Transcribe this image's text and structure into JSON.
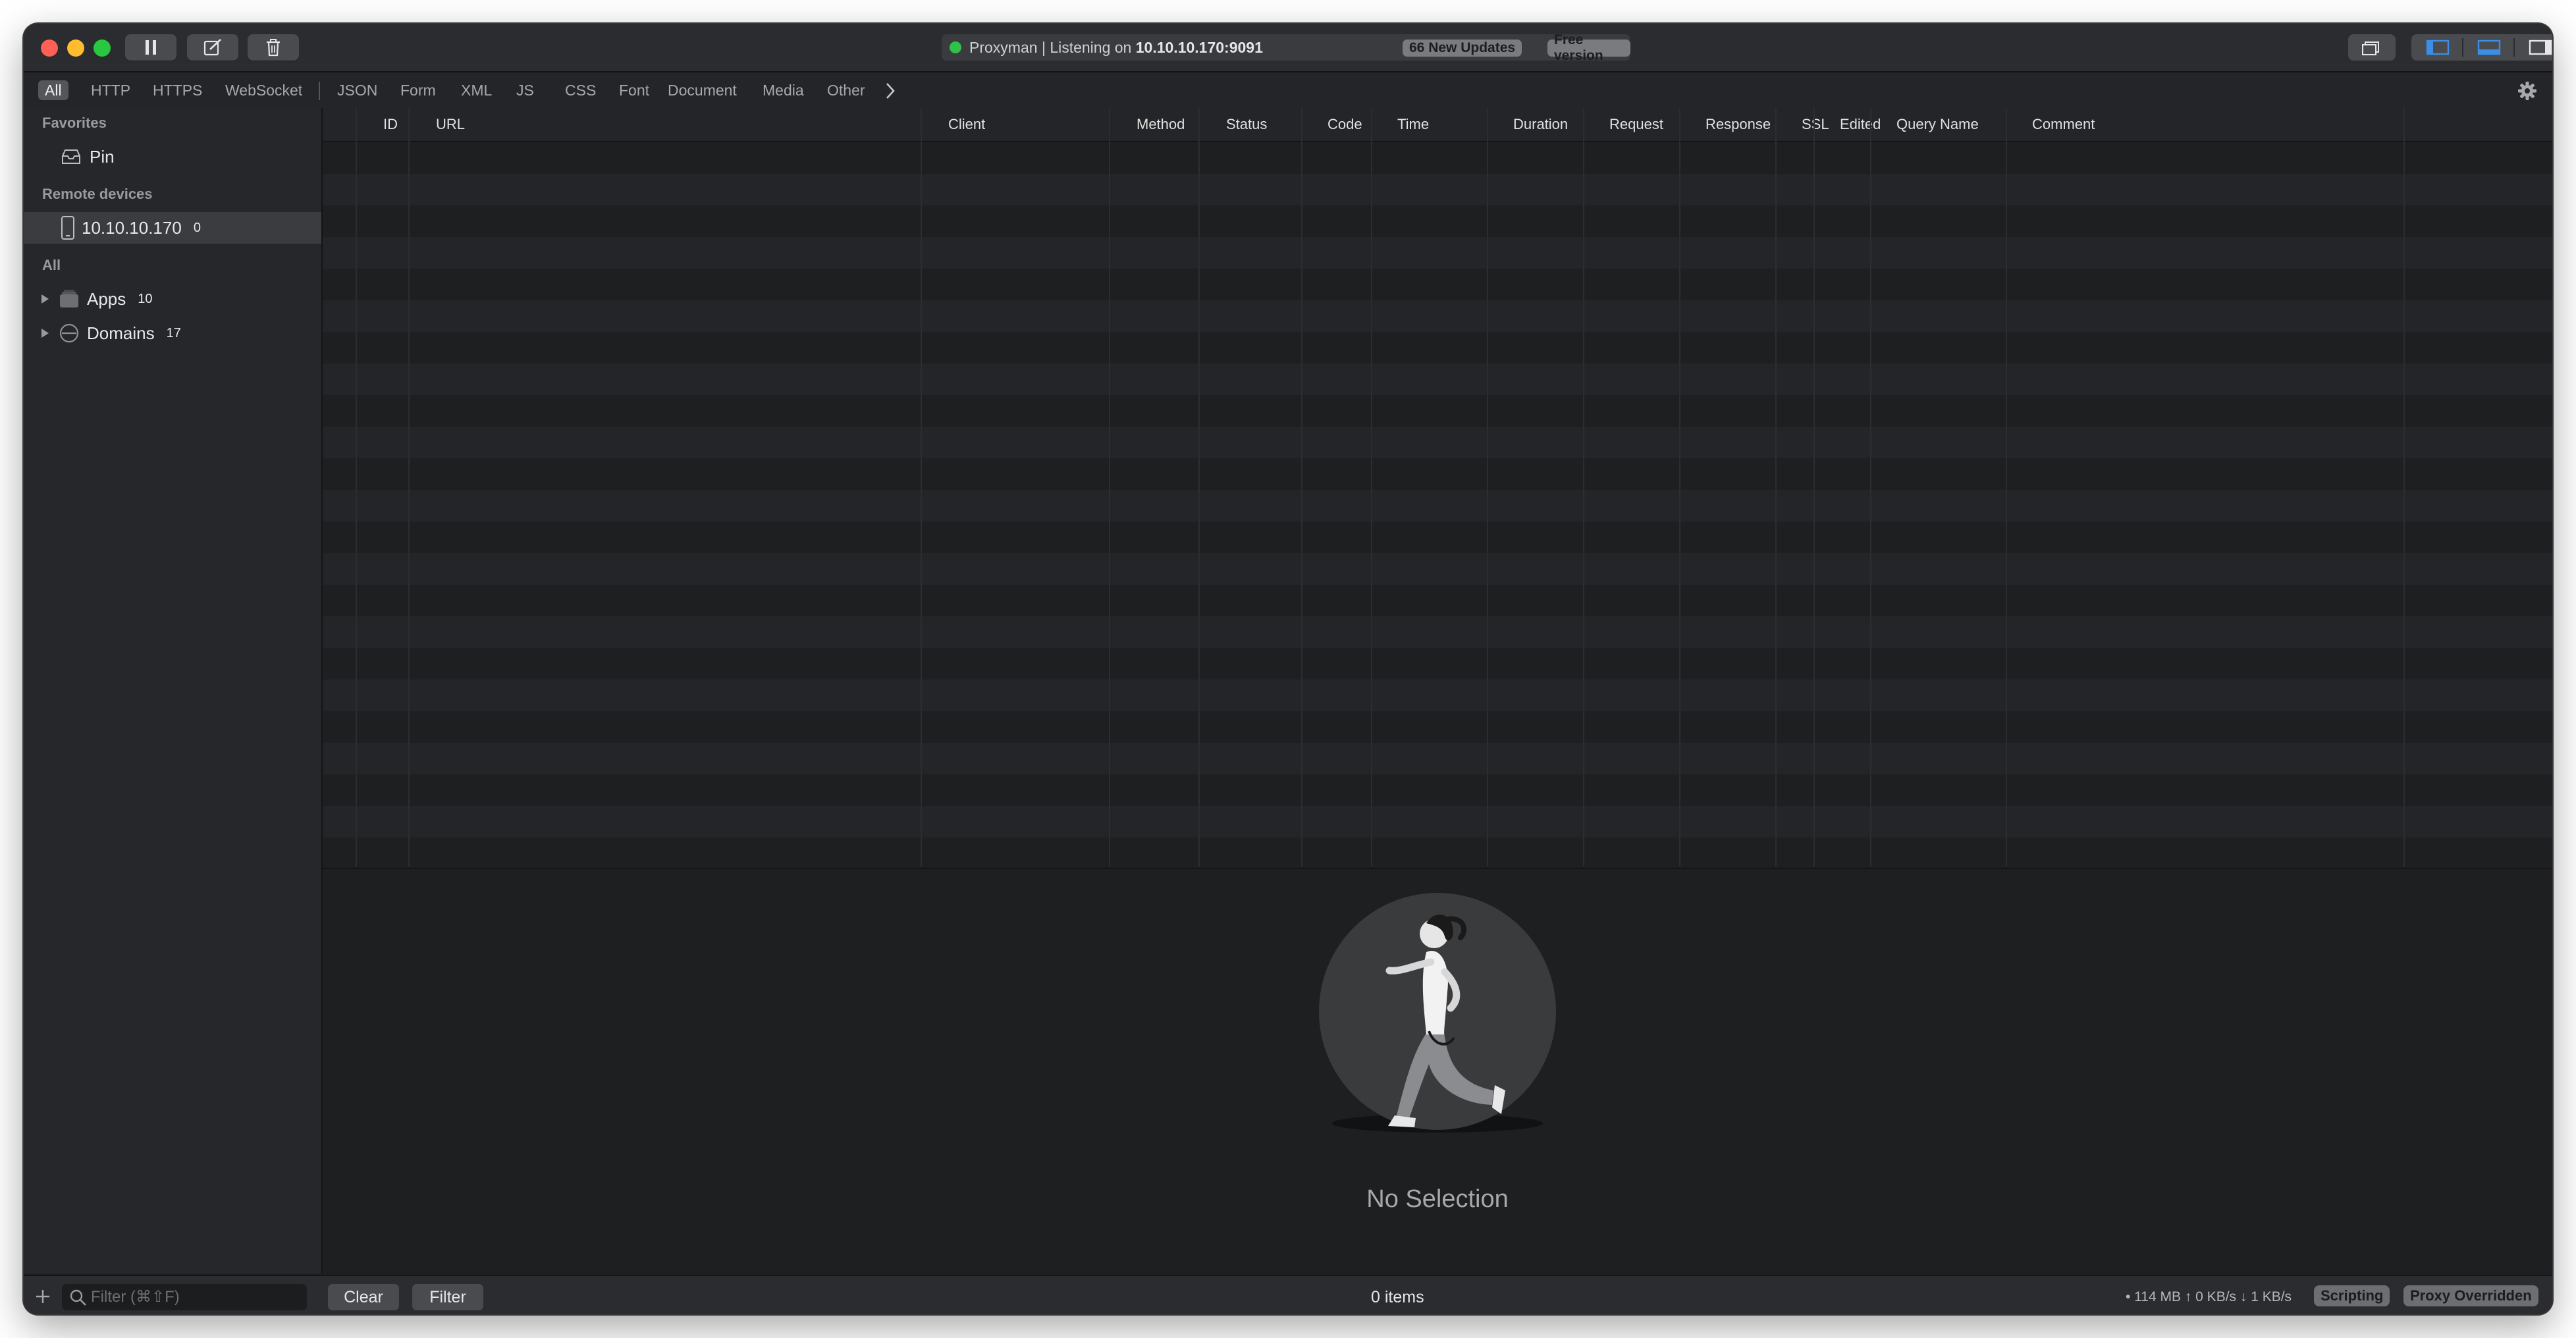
{
  "titlebar": {
    "status_app": "Proxyman",
    "status_separator": "|",
    "status_listening": "Listening on",
    "status_address": "10.10.10.170:9091",
    "updates_badge": "66 New Updates",
    "version_badge": "Free version"
  },
  "filter_tabs": [
    "All",
    "HTTP",
    "HTTPS",
    "WebSocket",
    "JSON",
    "Form",
    "XML",
    "JS",
    "CSS",
    "Font",
    "Document",
    "Media",
    "Other"
  ],
  "sidebar": {
    "favorites_header": "Favorites",
    "pin_label": "Pin",
    "remote_header": "Remote devices",
    "device_label": "10.10.10.170",
    "device_count": "0",
    "all_header": "All",
    "apps_label": "Apps",
    "apps_count": "10",
    "domains_label": "Domains",
    "domains_count": "17"
  },
  "table": {
    "columns": [
      "ID",
      "URL",
      "Client",
      "Method",
      "Status",
      "Code",
      "Time",
      "Duration",
      "Request",
      "Response",
      "SSL",
      "Edited",
      "Query Name",
      "Comment"
    ]
  },
  "detail": {
    "empty_text": "No Selection"
  },
  "bottombar": {
    "filter_placeholder": "Filter (⌘⇧F)",
    "clear_label": "Clear",
    "filter_label": "Filter",
    "items_count": "0 items",
    "stats": "• 114 MB ↑ 0 KB/s ↓ 1 KB/s",
    "scripting_badge": "Scripting",
    "proxy_badge": "Proxy Overridden"
  },
  "colors": {
    "window_bg": "#1e1f21",
    "sidebar_bg": "#26272a",
    "status_green": "#2fc14a",
    "accent_blue": "#3a8ee6"
  }
}
